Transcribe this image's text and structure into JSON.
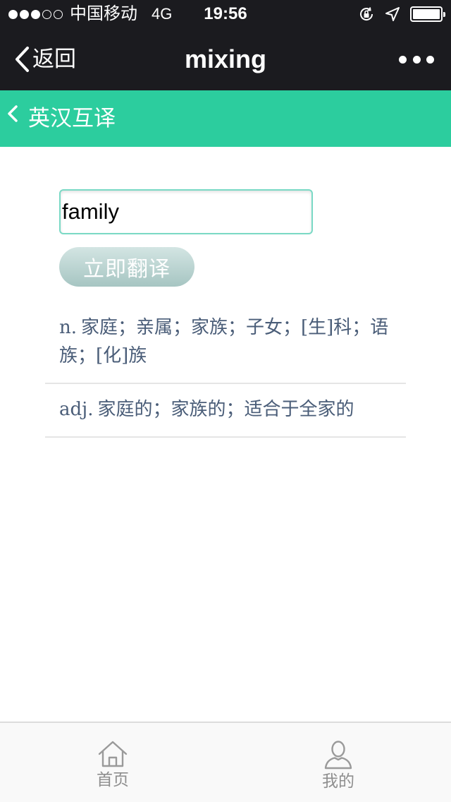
{
  "status_bar": {
    "signal_dots": {
      "filled": 3,
      "total": 5
    },
    "carrier": "中国移动",
    "network": "4G",
    "time": "19:56",
    "battery_level": 1.0
  },
  "nav": {
    "back_label": "返回",
    "title": "mixing"
  },
  "header": {
    "title": "英汉互译"
  },
  "search": {
    "input_value": "family",
    "button_label": "立即翻译"
  },
  "results": [
    {
      "pos": "n.",
      "text": "家庭；亲属；家族；子女；[生]科；语族；[化]族"
    },
    {
      "pos": "adj.",
      "text": "家庭的；家族的；适合于全家的"
    }
  ],
  "tabbar": {
    "items": [
      {
        "label": "首页",
        "icon": "home-icon"
      },
      {
        "label": "我的",
        "icon": "user-icon"
      }
    ]
  },
  "colors": {
    "status_bg": "#1b1b1f",
    "header_green": "#2ccd9e",
    "result_text": "#4a5d78"
  }
}
